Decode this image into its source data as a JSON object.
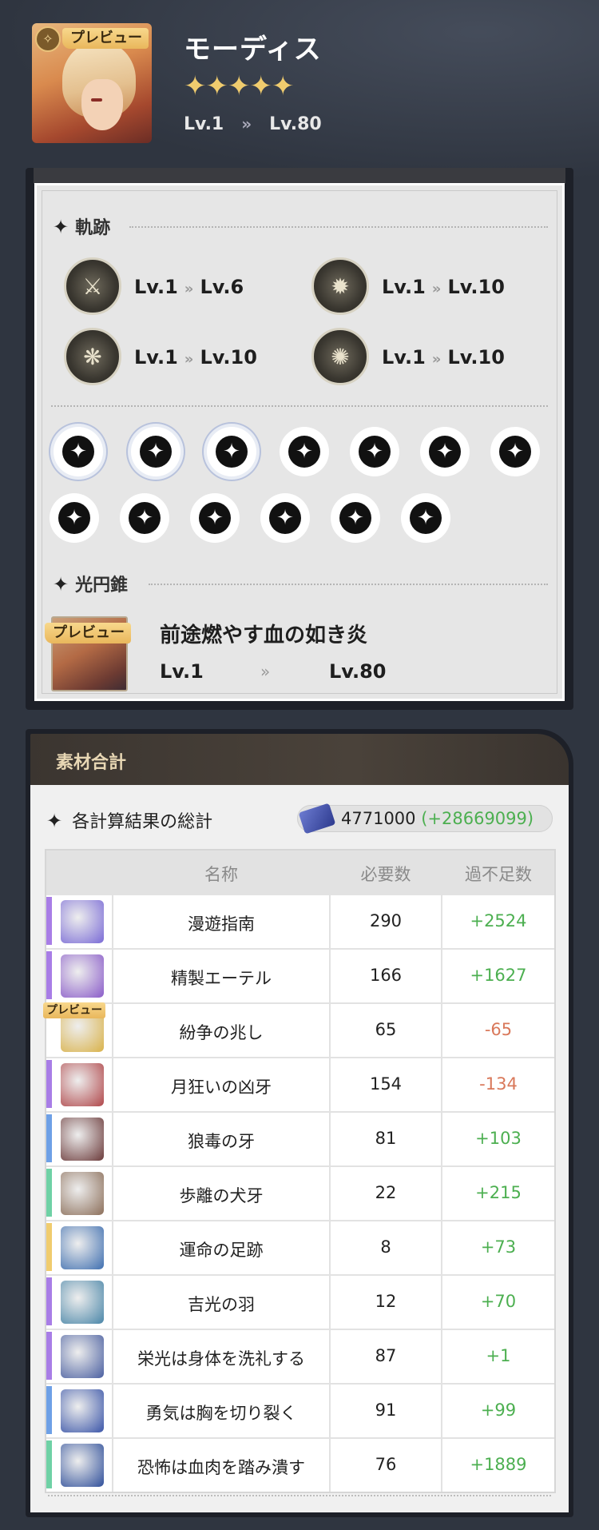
{
  "header": {
    "preview_label": "プレビュー",
    "character_name": "モーディス",
    "stars": "✦✦✦✦✦",
    "level_from": "Lv.1",
    "level_to": "Lv.80",
    "level_arrow": "»"
  },
  "traces": {
    "title": "軌跡",
    "items": [
      {
        "icon": "attack-trace-icon",
        "from": "Lv.1",
        "to": "Lv.6"
      },
      {
        "icon": "skill-trace-icon",
        "from": "Lv.1",
        "to": "Lv.10"
      },
      {
        "icon": "ultimate-trace-icon",
        "from": "Lv.1",
        "to": "Lv.10"
      },
      {
        "icon": "talent-trace-icon",
        "from": "Lv.1",
        "to": "Lv.10"
      }
    ],
    "arrow": "»",
    "node_glyph": "✦"
  },
  "light_cone": {
    "title": "光円錐",
    "preview_label": "プレビュー",
    "name": "前途燃やす血の如き炎",
    "level_from": "Lv.1",
    "level_to": "Lv.80",
    "arrow": "»"
  },
  "materials": {
    "section_title": "素材合計",
    "summary_title": "各計算結果の総計",
    "credits": "4771000",
    "credits_diff": "(+28669099)",
    "columns": [
      "名称",
      "必要数",
      "過不足数"
    ],
    "rows": [
      {
        "name": "漫遊指南",
        "need": "290",
        "diff": "+2524",
        "rarity": "#a87de6",
        "positive": true
      },
      {
        "name": "精製エーテル",
        "need": "166",
        "diff": "+1627",
        "rarity": "#a87de6",
        "positive": true
      },
      {
        "name": "紛争の兆し",
        "need": "65",
        "diff": "-65",
        "rarity": "#ffffff",
        "positive": false,
        "preview": "プレビュー"
      },
      {
        "name": "月狂いの凶牙",
        "need": "154",
        "diff": "-134",
        "rarity": "#a87de6",
        "positive": false
      },
      {
        "name": "狼毒の牙",
        "need": "81",
        "diff": "+103",
        "rarity": "#6ea0e6",
        "positive": true
      },
      {
        "name": "歩離の犬牙",
        "need": "22",
        "diff": "+215",
        "rarity": "#6fd1a5",
        "positive": true
      },
      {
        "name": "運命の足跡",
        "need": "8",
        "diff": "+73",
        "rarity": "#f0cc6e",
        "positive": true
      },
      {
        "name": "吉光の羽",
        "need": "12",
        "diff": "+70",
        "rarity": "#a87de6",
        "positive": true
      },
      {
        "name": "栄光は身体を洗礼する",
        "need": "87",
        "diff": "+1",
        "rarity": "#a87de6",
        "positive": true
      },
      {
        "name": "勇気は胸を切り裂く",
        "need": "91",
        "diff": "+99",
        "rarity": "#6ea0e6",
        "positive": true
      },
      {
        "name": "恐怖は血肉を踏み潰す",
        "need": "76",
        "diff": "+1889",
        "rarity": "#6fd1a5",
        "positive": true
      }
    ]
  },
  "colors": {
    "positive": "#4caf50",
    "negative": "#d9785a",
    "preview_tag": "#f0c878"
  }
}
